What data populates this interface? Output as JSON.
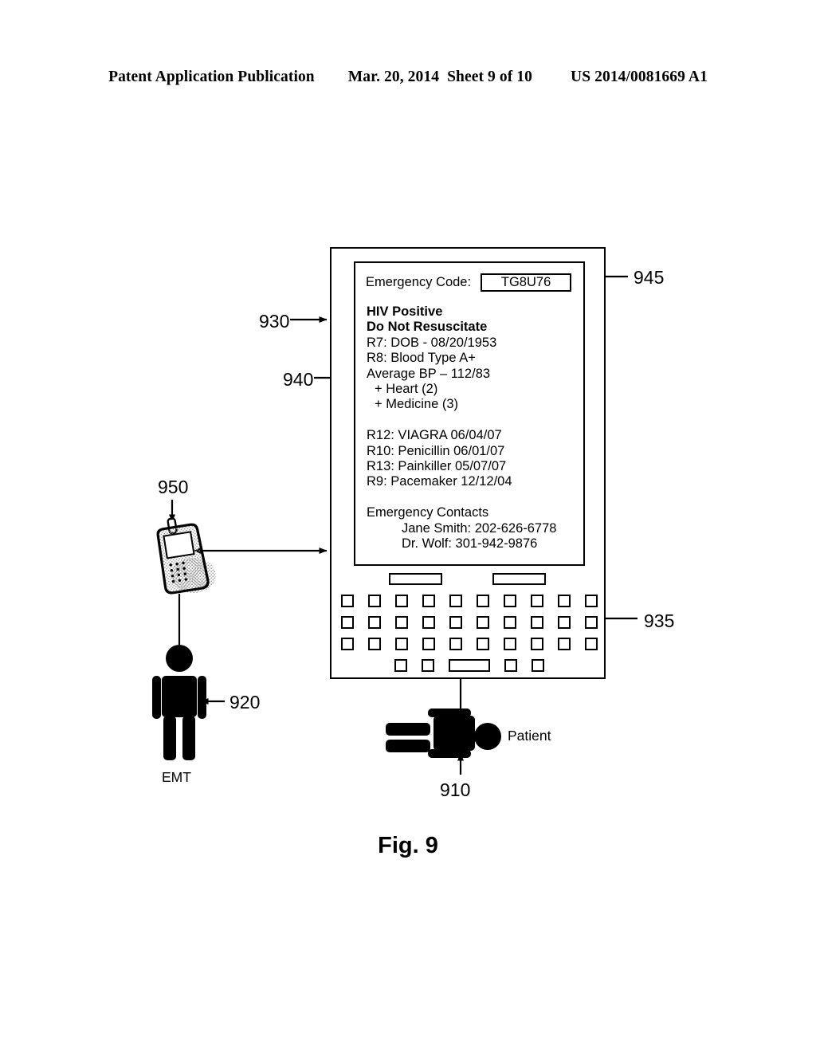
{
  "page_header": {
    "publication": "Patent Application Publication",
    "date": "Mar. 20, 2014",
    "sheet": "Sheet 9 of 10",
    "patent_number": "US 2014/0081669 A1"
  },
  "figure": {
    "caption": "Fig. 9"
  },
  "device": {
    "screen": {
      "emergency_code_label": "Emergency Code:",
      "emergency_code_value": "TG8U76",
      "alerts": [
        "HIV Positive",
        "Do Not Resuscitate"
      ],
      "vitals": [
        "R7: DOB - 08/20/1953",
        "R8: Blood Type A+",
        "Average BP – 112/83"
      ],
      "categories": [
        "+ Heart (2)",
        "+ Medicine (3)"
      ],
      "records": [
        "R12: VIAGRA 06/04/07",
        "R10: Penicillin 06/01/07",
        "R13: Painkiller 05/07/07",
        "R9: Pacemaker 12/12/04"
      ],
      "contacts_heading": "Emergency Contacts",
      "contacts": [
        "Jane Smith: 202-626-6778",
        "Dr. Wolf:  301-942-9876"
      ]
    },
    "keyboard": {
      "softkeys": [
        "",
        ""
      ],
      "rows": [
        10,
        10,
        10
      ],
      "bottom_row_keys": 4
    }
  },
  "reference_numerals": {
    "device_body": "930",
    "screen": "940",
    "emergency_code_box": "945",
    "keyboard": "935",
    "mobile_phone": "950",
    "emt_person": "920",
    "patient": "910"
  },
  "labels": {
    "emt": "EMT",
    "patient": "Patient"
  },
  "colors": {
    "ink": "#000000",
    "background": "#ffffff"
  }
}
